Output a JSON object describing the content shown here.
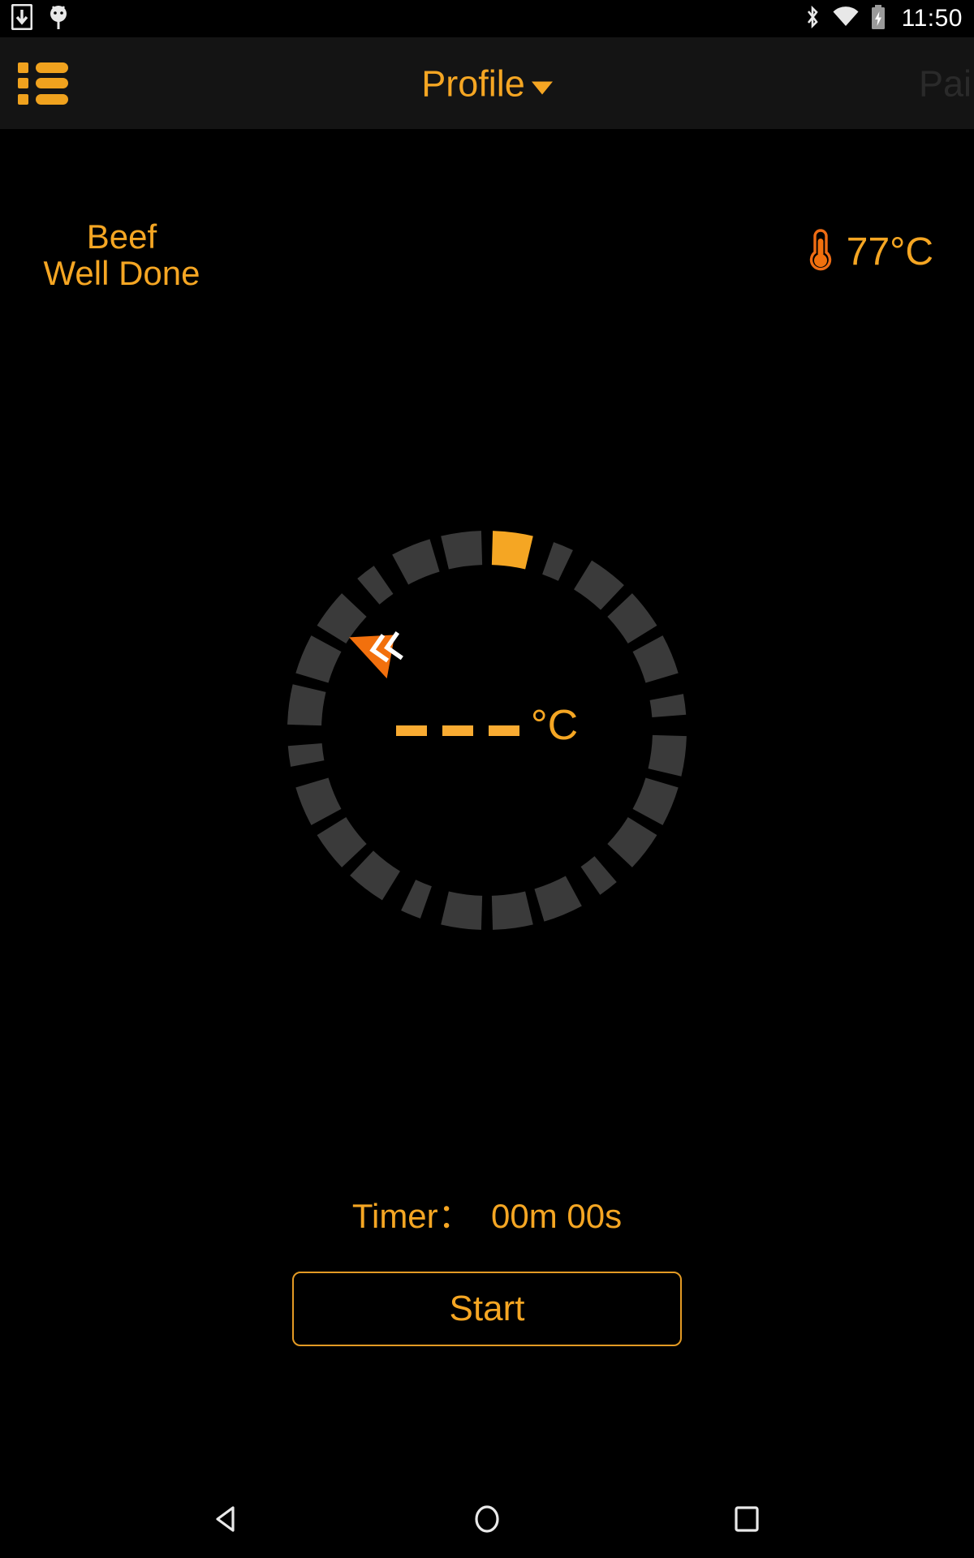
{
  "status_bar": {
    "icons": [
      "download-icon",
      "android-debug-icon"
    ],
    "right_icons": [
      "bluetooth-icon",
      "wifi-icon",
      "battery-charging-icon"
    ],
    "time": "11:50"
  },
  "app_bar": {
    "menu_icon": "list-menu-icon",
    "title": "Profile",
    "caret": "chevron-down-icon",
    "action_label": "Pair"
  },
  "profile": {
    "meat": "Beef",
    "doneness": "Well Done",
    "target_icon": "thermometer-icon",
    "target_temperature": "77°C"
  },
  "gauge": {
    "probe_value": "- - -",
    "unit": "°C",
    "marker_icon": "double-chevron-marker-icon",
    "colors": {
      "segment": "#3a3a3a",
      "active_segment": "#f5a623",
      "marker": "#f2700d",
      "background": "#000000"
    },
    "segment_count": 24,
    "active_segment_index": 0
  },
  "timer": {
    "label": "Timer：",
    "value": "00m 00s"
  },
  "actions": {
    "start_label": "Start"
  },
  "nav_bar": {
    "back": "back-triangle-icon",
    "home": "home-circle-icon",
    "recents": "recents-square-icon"
  },
  "theme": {
    "accent": "#f5a623",
    "accent_deep": "#f2700d",
    "appbar_bg": "#141414",
    "dim_text": "#2a2a2a"
  }
}
